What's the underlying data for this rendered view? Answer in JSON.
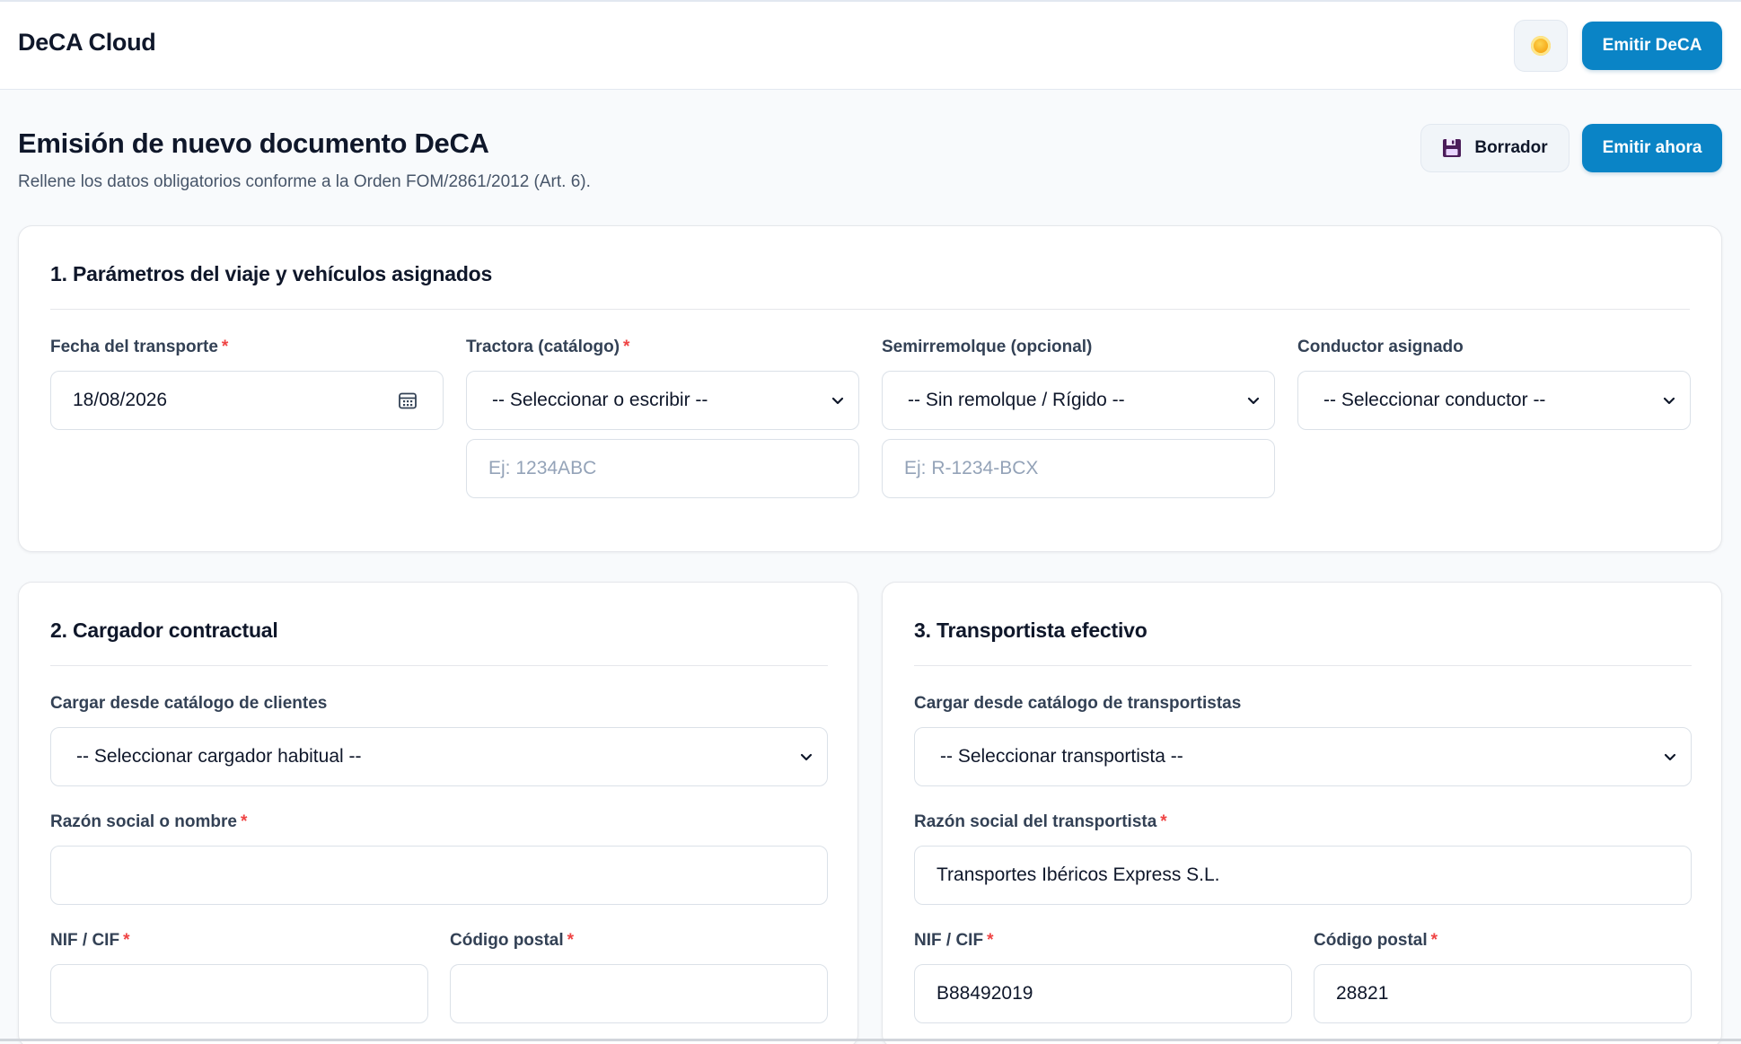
{
  "app": {
    "title": "DeCA Cloud",
    "theme_icon": "sun-icon",
    "emit_button": "Emitir DeCA"
  },
  "page": {
    "title": "Emisión de nuevo documento DeCA",
    "subtitle": "Rellene los datos obligatorios conforme a la Orden FOM/2861/2012 (Art. 6).",
    "draft_icon": "floppy-disk-icon",
    "draft_button": "Borrador",
    "emit_now_button": "Emitir ahora"
  },
  "colors": {
    "primary": "#0a84c6",
    "required": "#ef4444",
    "background": "#f8fafc"
  },
  "section1": {
    "title": "1. Parámetros del viaje y vehículos asignados",
    "date": {
      "label": "Fecha del transporte",
      "required": "*",
      "value": "18/08/2026",
      "icon": "calendar-icon"
    },
    "tractor": {
      "label": "Tractora (catálogo)",
      "required": "*",
      "selected": "-- Seleccionar o escribir --",
      "placeholder": "Ej: 1234ABC"
    },
    "trailer": {
      "label": "Semirremolque (opcional)",
      "selected": "-- Sin remolque / Rígido --",
      "placeholder": "Ej: R-1234-BCX"
    },
    "driver": {
      "label": "Conductor asignado",
      "selected": "-- Seleccionar conductor --"
    }
  },
  "section2": {
    "title": "2. Cargador contractual",
    "catalog": {
      "label": "Cargar desde catálogo de clientes",
      "selected": "-- Seleccionar cargador habitual --"
    },
    "name": {
      "label": "Razón social o nombre",
      "required": "*",
      "value": ""
    },
    "nif": {
      "label": "NIF / CIF",
      "required": "*",
      "value": ""
    },
    "postal": {
      "label": "Código postal",
      "required": "*",
      "value": ""
    }
  },
  "section3": {
    "title": "3. Transportista efectivo",
    "catalog": {
      "label": "Cargar desde catálogo de transportistas",
      "selected": "-- Seleccionar transportista --"
    },
    "name": {
      "label": "Razón social del transportista",
      "required": "*",
      "value": "Transportes Ibéricos Express S.L."
    },
    "nif": {
      "label": "NIF / CIF",
      "required": "*",
      "value": "B88492019"
    },
    "postal": {
      "label": "Código postal",
      "required": "*",
      "value": "28821"
    }
  }
}
